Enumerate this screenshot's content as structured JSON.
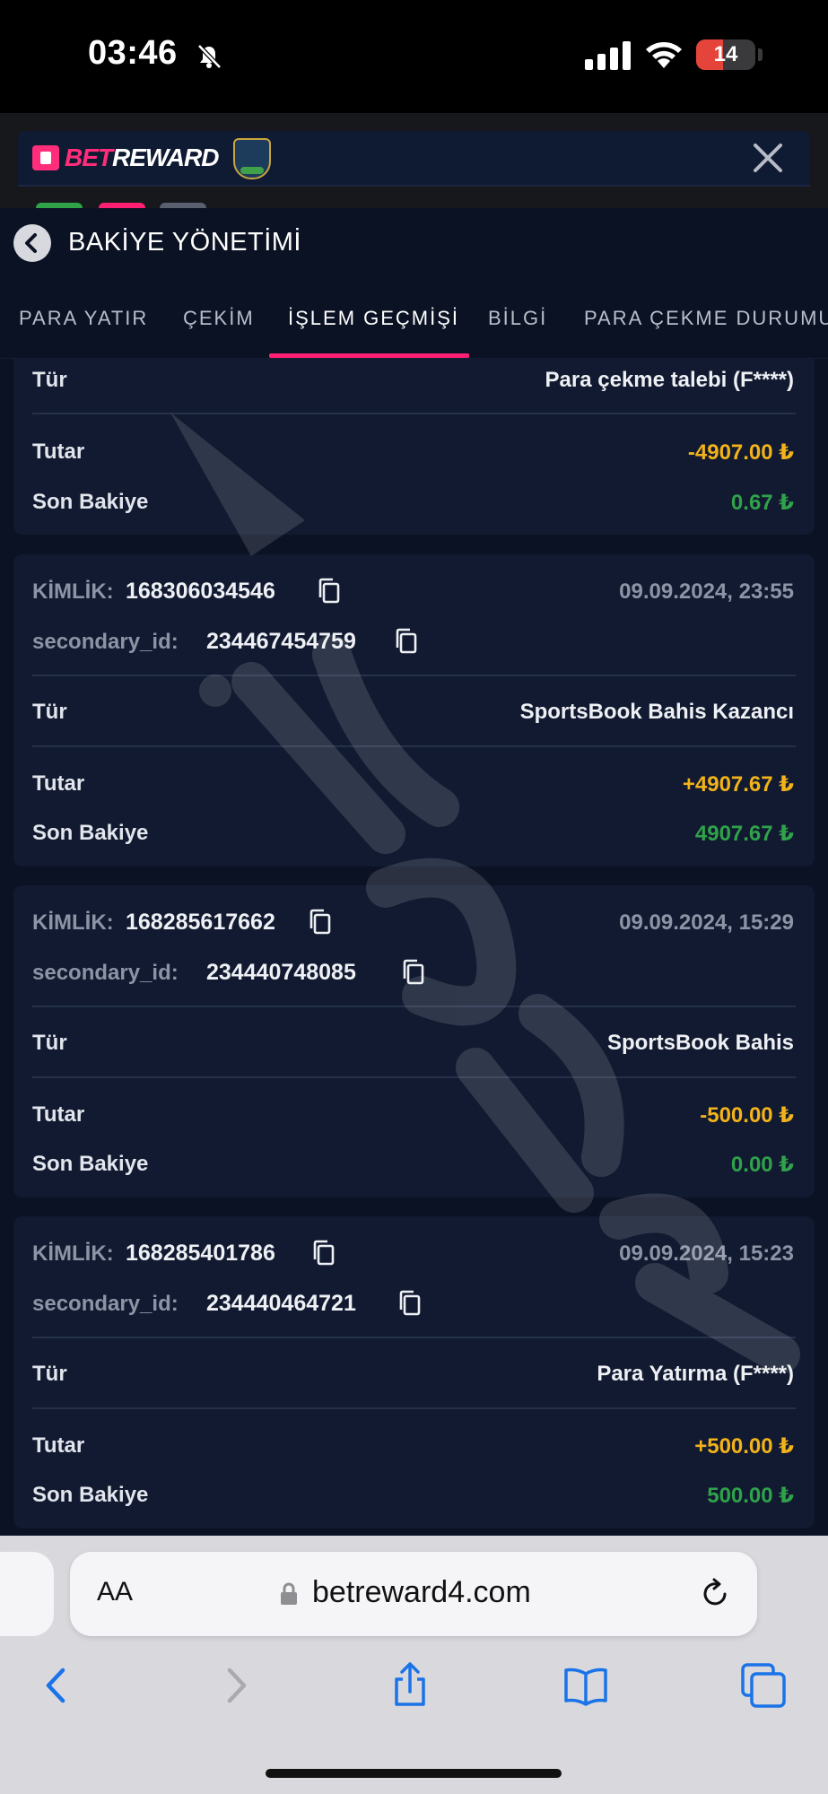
{
  "status_bar": {
    "time": "03:46",
    "battery": "14",
    "battery_level": 0.14
  },
  "site": {
    "logo_bet": "BET",
    "logo_reward": "REWARD"
  },
  "panel": {
    "title": "BAKİYE YÖNETİMİ"
  },
  "tabs": [
    {
      "label": "PARA YATIR"
    },
    {
      "label": "ÇEKİM"
    },
    {
      "label": "İŞLEM GEÇMİŞİ",
      "active": true
    },
    {
      "label": "BİLGİ"
    },
    {
      "label": "PARA ÇEKME DURUMU"
    }
  ],
  "labels": {
    "id": "KİMLİK:",
    "secondary_id": "secondary_id:",
    "type": "Tür",
    "amount": "Tutar",
    "balance": "Son Bakiye"
  },
  "transactions": [
    {
      "type": "Para çekme talebi (F****)",
      "amount": "-4907.00 ₺",
      "balance": "0.67 ₺"
    },
    {
      "id": "168306034546",
      "date": "09.09.2024, 23:55",
      "secondary_id": "234467454759",
      "type": "SportsBook Bahis Kazancı",
      "amount": "+4907.67 ₺",
      "balance": "4907.67 ₺"
    },
    {
      "id": "168285617662",
      "date": "09.09.2024, 15:29",
      "secondary_id": "234440748085",
      "type": "SportsBook Bahis",
      "amount": "-500.00 ₺",
      "balance": "0.00 ₺"
    },
    {
      "id": "168285401786",
      "date": "09.09.2024, 15:23",
      "secondary_id": "234440464721",
      "type": "Para Yatırma (F****)",
      "amount": "+500.00 ₺",
      "balance": "500.00 ₺"
    }
  ],
  "browser": {
    "aa": "AA",
    "url": "betreward4.com"
  },
  "colors": {
    "accent": "#ff1f73",
    "amount": "#f2b21a",
    "balance": "#2fa24a",
    "card": "#111a30",
    "background": "#0b1224"
  }
}
